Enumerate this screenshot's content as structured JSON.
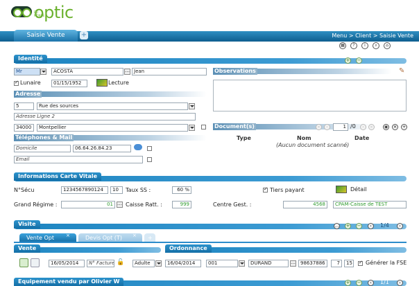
{
  "app": {
    "logo": "optic",
    "logo_small": "DU MONDE"
  },
  "tabs": {
    "main": "Saisie Vente",
    "plus": "+"
  },
  "breadcrumb": "Menu > Client > Saisie Vente",
  "identite": {
    "title": "Identité",
    "civilite": "Mr",
    "nom": "ACOSTA",
    "prenom": "Jean",
    "lunaire_label": "Lunaire",
    "date_naissance": "01/15/1952",
    "lecture_label": "Lecture"
  },
  "observations": {
    "title": "Observations"
  },
  "adresse": {
    "title": "Adresse",
    "numero": "5",
    "rue": "Rue des sources",
    "ligne2_placeholder": "Adresse Ligne 2",
    "cp": "34000",
    "ville": "Montpellier"
  },
  "documents": {
    "title": "Document(s)",
    "page": "1",
    "total": "/0",
    "col_type": "Type",
    "col_nom": "Nom",
    "col_date": "Date",
    "empty": "(Aucun document scanné)"
  },
  "telephones": {
    "title": "Téléphones & Mail",
    "type_tel": "Domicile",
    "tel": "06.64.26.84.23",
    "email_placeholder": "Email"
  },
  "vitale": {
    "title": "Informations Carte Vitale",
    "nsecu_label": "N°Sécu",
    "nsecu": "1234567890124",
    "cle": "10",
    "taux_label": "Taux SS :",
    "taux": "60 %",
    "tiers_label": "Tiers payant",
    "detail_label": "Détail",
    "regime_label": "Grand Régime :",
    "regime": "01",
    "caisse_label": "Caisse Ratt. :",
    "caisse": "999",
    "centre_label": "Centre Gest. :",
    "centre": "4568",
    "cpam": "CPAM-Caisse de TEST"
  },
  "visite": {
    "title": "Visite",
    "page": "1/4",
    "tab_vente": "Vente Opt",
    "tab_devis": "Devis Opt (T)",
    "tab_plus": "+",
    "close": "×"
  },
  "vente": {
    "title": "Vente",
    "date": "16/05/2014",
    "facture_placeholder": "N° Facture",
    "client_type": "Adulte"
  },
  "ordonnance": {
    "title": "Ordonnance",
    "date": "16/04/2014",
    "code": "001",
    "medecin": "DURAND",
    "num": "98637886",
    "v1": "7",
    "v2": "15",
    "fse_label": "Générer la FSE"
  },
  "equipement": {
    "title": "Equipement vendu par Olivier W",
    "page": "1/1"
  },
  "colors": {
    "accent": "#1c84c0",
    "brand": "#6bb12e"
  }
}
